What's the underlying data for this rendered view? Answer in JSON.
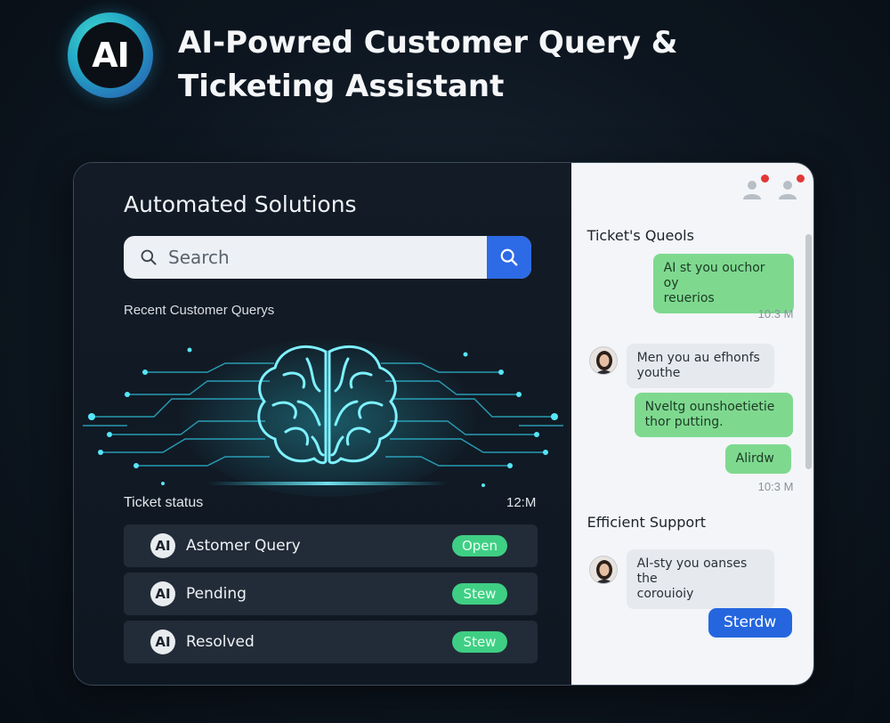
{
  "header": {
    "logo_text": "AI",
    "title_line1": "AI-Powred Customer Query &",
    "title_line2": "Ticketing Assistant"
  },
  "left_panel": {
    "title": "Automated Solutions",
    "search": {
      "placeholder": "Search",
      "value": ""
    },
    "recent_label": "Recent Customer Querys",
    "ticket_status_label": "Ticket status",
    "ticket_status_time": "12:M",
    "tickets": [
      {
        "badge": "AI",
        "label": "Astomer Query",
        "status": "Open"
      },
      {
        "badge": "AI",
        "label": "Pending",
        "status": "Stew"
      },
      {
        "badge": "AI",
        "label": "Resolved",
        "status": "Stew"
      }
    ]
  },
  "right_panel": {
    "heading1": "Ticket's Queols",
    "heading2": "Efficient Support",
    "messages": [
      {
        "type": "outgoing",
        "text_line1": "AI st you ouchor oy",
        "text_line2": "reuerios"
      },
      {
        "type": "time",
        "text": "10:3 M"
      },
      {
        "type": "incoming",
        "text_line1": "Men you au efhonfs",
        "text_line2": "youthe"
      },
      {
        "type": "outgoing",
        "text_line1": "Nveltg ounshoetietie",
        "text_line2": "thor putting."
      },
      {
        "type": "outgoing",
        "text_line1": "Alirdw",
        "text_line2": ""
      },
      {
        "type": "time",
        "text": "10:3 M"
      },
      {
        "type": "incoming",
        "text_line1": "AI-sty you oanses the",
        "text_line2": "corouioiy"
      },
      {
        "type": "action",
        "text": "Sterdw"
      }
    ]
  },
  "colors": {
    "accent_blue": "#2d6ae6",
    "status_green": "#3fcf84",
    "bubble_green": "#7ed98f",
    "notification_red": "#e33636"
  }
}
